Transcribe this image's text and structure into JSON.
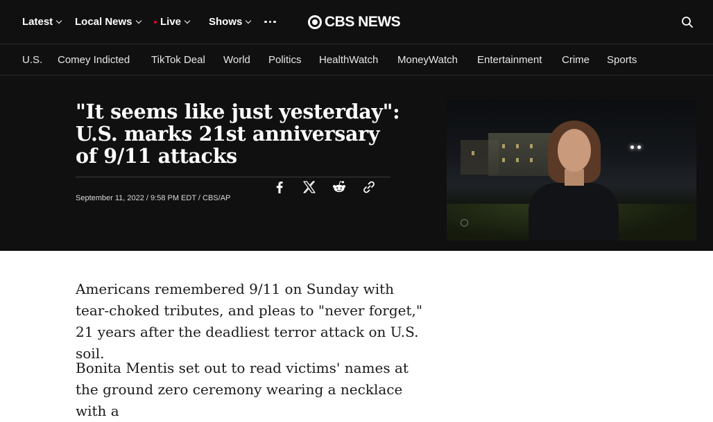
{
  "topnav": {
    "items": [
      {
        "label": "Latest"
      },
      {
        "label": "Local News"
      },
      {
        "label": "Live"
      },
      {
        "label": "Shows"
      }
    ],
    "logo_text": "CBS NEWS"
  },
  "subnav": {
    "items": [
      "U.S.",
      "Comey Indicted",
      "TikTok Deal",
      "World",
      "Politics",
      "HealthWatch",
      "MoneyWatch",
      "Entertainment",
      "Crime",
      "Sports"
    ]
  },
  "article": {
    "headline": "\"It seems like just yesterday\": U.S. marks 21st anniversary of 9/11 attacks",
    "meta": "September 11, 2022 / 9:58 PM EDT / CBS/AP",
    "paragraphs": [
      "Americans remembered 9/11 on Sunday with tear-choked tributes, and pleas to \"never forget,\" 21 years after the deadliest terror attack on U.S. soil.",
      "Bonita Mentis set out to read victims' names at the ground zero ceremony wearing a necklace with a"
    ]
  },
  "colors": {
    "background": "#101010",
    "live_dot": "#e4002b"
  }
}
